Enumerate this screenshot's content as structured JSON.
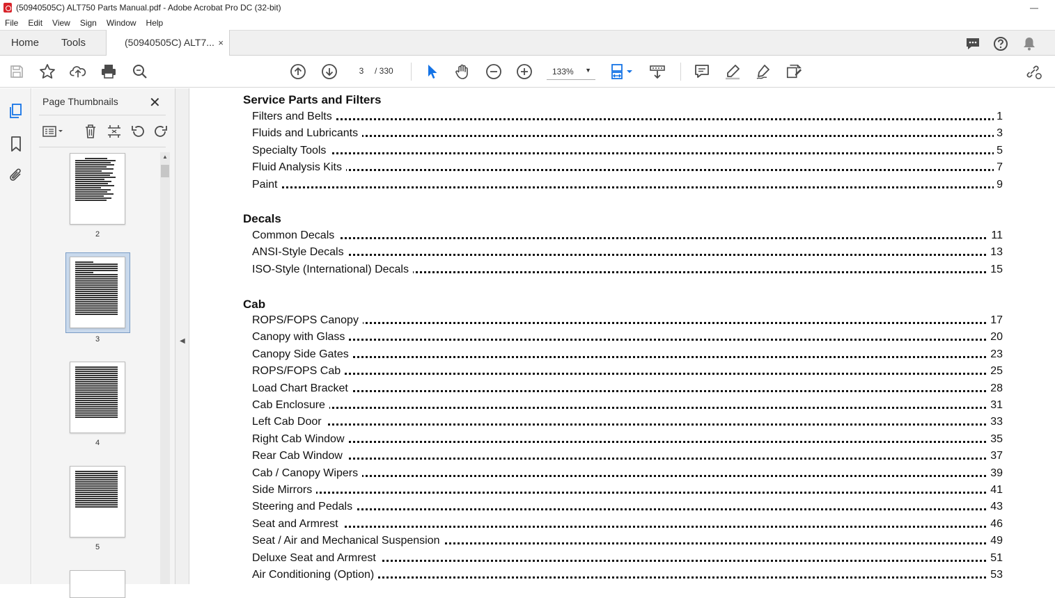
{
  "window": {
    "title": "(50940505C) ALT750 Parts Manual.pdf - Adobe Acrobat Pro DC (32-bit)",
    "minimize_label": "—"
  },
  "menu": [
    "File",
    "Edit",
    "View",
    "Sign",
    "Window",
    "Help"
  ],
  "tabs": {
    "home": "Home",
    "tools": "Tools",
    "document": "(50940505C) ALT7...",
    "close": "×"
  },
  "toolbar": {
    "page_current": "3",
    "page_total": "/ 330",
    "zoom": "133%"
  },
  "thumbnails_panel": {
    "title": "Page Thumbnails",
    "close": "✕",
    "pages": [
      "2",
      "3",
      "4",
      "5"
    ],
    "selected_page": "3"
  },
  "toc": [
    {
      "title": "Service Parts and Filters",
      "items": [
        {
          "label": "Filters and Belts",
          "page": "1"
        },
        {
          "label": "Fluids and Lubricants",
          "page": "3"
        },
        {
          "label": "Specialty Tools",
          "page": "5"
        },
        {
          "label": "Fluid Analysis Kits",
          "page": "7"
        },
        {
          "label": "Paint",
          "page": "9"
        }
      ]
    },
    {
      "title": "Decals",
      "items": [
        {
          "label": "Common Decals",
          "page": "11"
        },
        {
          "label": "ANSI-Style Decals",
          "page": "13"
        },
        {
          "label": "ISO-Style (International) Decals",
          "page": "15"
        }
      ]
    },
    {
      "title": "Cab",
      "items": [
        {
          "label": "ROPS/FOPS Canopy",
          "page": "17"
        },
        {
          "label": "Canopy with Glass",
          "page": "20"
        },
        {
          "label": "Canopy Side Gates",
          "page": "23"
        },
        {
          "label": "ROPS/FOPS Cab",
          "page": "25"
        },
        {
          "label": "Load Chart Bracket",
          "page": "28"
        },
        {
          "label": "Cab Enclosure",
          "page": "31"
        },
        {
          "label": "Left Cab Door",
          "page": "33"
        },
        {
          "label": "Right Cab Window",
          "page": "35"
        },
        {
          "label": "Rear Cab Window",
          "page": "37"
        },
        {
          "label": "Cab / Canopy Wipers",
          "page": "39"
        },
        {
          "label": "Side Mirrors",
          "page": "41"
        },
        {
          "label": "Steering and Pedals",
          "page": "43"
        },
        {
          "label": "Seat and Armrest",
          "page": "46"
        },
        {
          "label": "Seat / Air and Mechanical Suspension",
          "page": "49"
        },
        {
          "label": "Deluxe Seat and Armrest",
          "page": "51"
        },
        {
          "label": "Air Conditioning (Option)",
          "page": "53"
        }
      ]
    }
  ],
  "colors": {
    "accent": "#1473e6",
    "icon": "#4b4b4b",
    "acrobat_red": "#d8232a"
  }
}
